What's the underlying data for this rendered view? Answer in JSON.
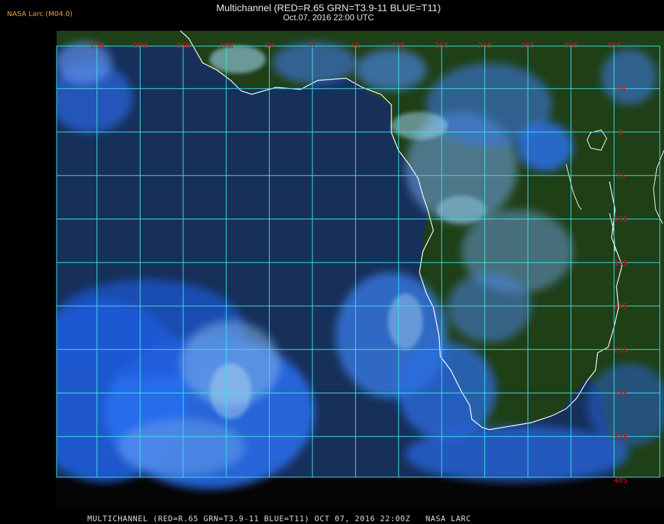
{
  "header": {
    "org": "NASA Larc (M04.0)",
    "title": "Multichannel (RED=R.65 GRN=T3.9-11 BLUE=T11)",
    "subtitle": "Oct.07, 2016 22:00 UTC"
  },
  "footer": {
    "caption": "MULTICHANNEL (RED=R.65 GRN=T3.9-11 BLUE=T11) OCT 07, 2016 22:00Z   NASA LARC"
  },
  "map": {
    "longitude_labels": [
      "25W",
      "20W",
      "15W",
      "10W",
      "5W",
      "0",
      "5E",
      "10E",
      "15E",
      "20E",
      "25E",
      "30E",
      "35E"
    ],
    "longitude_values": [
      -25,
      -20,
      -15,
      -10,
      -5,
      0,
      5,
      10,
      15,
      20,
      25,
      30,
      35
    ],
    "latitude_labels": [
      "5N",
      "0",
      "5S",
      "10S",
      "15S",
      "20S",
      "25S",
      "30S",
      "35S",
      "40S"
    ],
    "latitude_values": [
      5,
      0,
      -5,
      -10,
      -15,
      -20,
      -25,
      -30,
      -35,
      -40
    ],
    "colors": {
      "ocean": "#17305a",
      "land": "#1f3f16",
      "cloud_low": "#1e5fe0",
      "cloud_high": "#9fd6ee",
      "grid": "#3fe0e6",
      "coast": "#ffffff",
      "label": "#d01818"
    }
  }
}
